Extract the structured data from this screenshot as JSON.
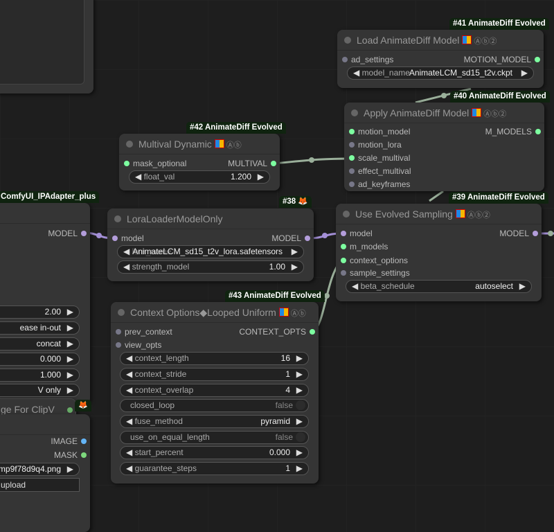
{
  "colors": {
    "model": "#b39ddb",
    "green": "#7dffa0",
    "image": "#64b5f6",
    "link_green": "#9aaf9a",
    "link_purple": "#a38fd6"
  },
  "ipadapter": {
    "badge": "ComfyUI_IPAdapter_plus",
    "output": "MODEL",
    "values": [
      "2.00",
      "ease in-out",
      "concat",
      "0.000",
      "1.000",
      "V only"
    ]
  },
  "clipv": {
    "title": "ge For ClipV",
    "badge_icon": "fox-icon"
  },
  "loadimage": {
    "outputs": [
      "IMAGE",
      "MASK"
    ],
    "image": "mp9f78d9q4.png",
    "upload": "upload"
  },
  "lora": {
    "badge": "#38",
    "title": "LoraLoaderModelOnly",
    "input": "model",
    "output": "MODEL",
    "widgets": [
      {
        "label": "lora_name",
        "value": "AnimateLCM_sd15_t2v_lora.safetensors"
      },
      {
        "label": "strength_model",
        "value": "1.00"
      }
    ]
  },
  "multival": {
    "badge": "#42 AnimateDiff Evolved",
    "title": "Multival Dynamic",
    "input": "mask_optional",
    "output": "MULTIVAL",
    "widget": {
      "label": "float_val",
      "value": "1.200"
    }
  },
  "loadad": {
    "badge": "#41 AnimateDiff Evolved",
    "title": "Load AnimateDiff Model",
    "input": "ad_settings",
    "output": "MOTION_MODEL",
    "widget": {
      "label": "model_name",
      "value": "AnimateLCM_sd15_t2v.ckpt"
    }
  },
  "apply": {
    "badge": "#40 AnimateDiff Evolved",
    "title": "Apply AnimateDiff Model",
    "inputs": [
      "motion_model",
      "motion_lora",
      "scale_multival",
      "effect_multival",
      "ad_keyframes"
    ],
    "output": "M_MODELS"
  },
  "evolved": {
    "badge": "#39 AnimateDiff Evolved",
    "title": "Use Evolved Sampling",
    "inputs": [
      "model",
      "m_models",
      "context_options",
      "sample_settings"
    ],
    "output": "MODEL",
    "widget": {
      "label": "beta_schedule",
      "value": "autoselect"
    }
  },
  "context": {
    "badge": "#43 AnimateDiff Evolved",
    "title": "Context Options◆Looped Uniform",
    "inputs": [
      "prev_context",
      "view_opts"
    ],
    "output": "CONTEXT_OPTS",
    "widgets": [
      {
        "label": "context_length",
        "value": "16"
      },
      {
        "label": "context_stride",
        "value": "1"
      },
      {
        "label": "context_overlap",
        "value": "4"
      },
      {
        "label": "closed_loop",
        "value": "false",
        "toggle": true
      },
      {
        "label": "fuse_method",
        "value": "pyramid"
      },
      {
        "label": "use_on_equal_length",
        "value": "false",
        "toggle": true
      },
      {
        "label": "start_percent",
        "value": "0.000"
      },
      {
        "label": "guarantee_steps",
        "value": "1"
      }
    ]
  }
}
